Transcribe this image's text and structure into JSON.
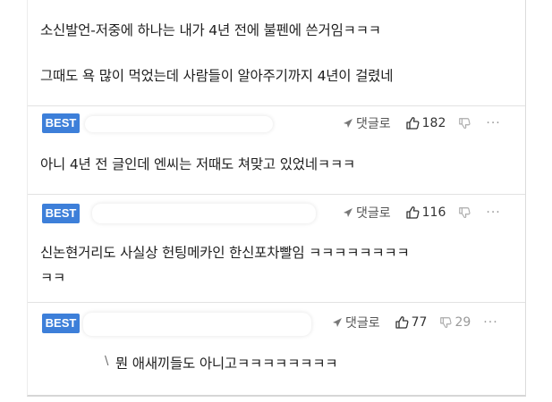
{
  "top_comment": {
    "line1": "소신발언-저중에 하나는 내가 4년 전에 불펜에 쓴거임ㅋㅋㅋ",
    "line2": "그때도 욕 많이 먹었는데 사람들이 알아주기까지 4년이 걸렸네"
  },
  "comments": [
    {
      "badge": "BEST",
      "reply_label": "댓글로",
      "likes": "182",
      "dislikes": "",
      "more": "···",
      "text_lines": [
        "아니 4년 전 글인데 엔씨는 저때도 쳐맞고 있었네ㅋㅋㅋ"
      ]
    },
    {
      "badge": "BEST",
      "reply_label": "댓글로",
      "likes": "116",
      "dislikes": "",
      "more": "···",
      "text_lines": [
        "신논현거리도 사실상 헌팅메카인 한신포차빨임 ㅋㅋㅋㅋㅋㅋㅋㅋ",
        "ㅋㅋ"
      ]
    },
    {
      "badge": "BEST",
      "reply_label": "댓글로",
      "likes": "77",
      "dislikes": "29",
      "more": "···",
      "text_prefix": "\\",
      "text_lines": [
        "뭔 애새끼들도 아니고ㅋㅋㅋㅋㅋㅋㅋㅋ"
      ]
    }
  ],
  "icons": {
    "reply": "reply-arrow-icon",
    "like": "thumbs-up-icon",
    "dislike": "thumbs-down-icon",
    "more": "more-dots-icon"
  },
  "colors": {
    "badge": "#3d7fd9"
  }
}
